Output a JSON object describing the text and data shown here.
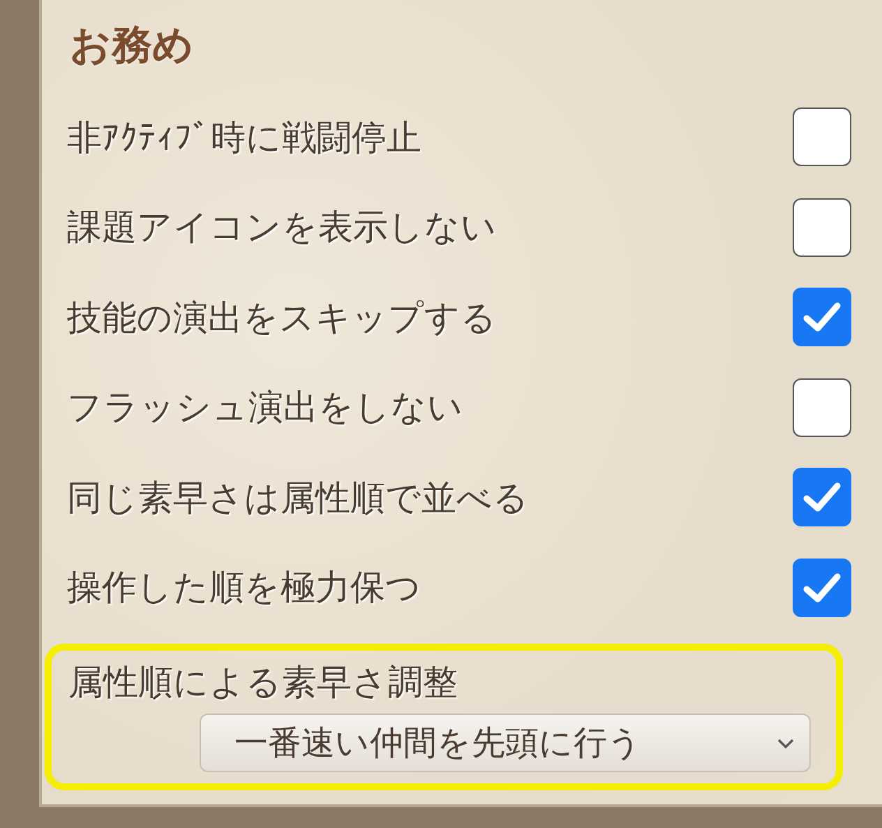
{
  "section": {
    "title": "お務め"
  },
  "options": [
    {
      "label": "非ｱｸﾃｨﾌﾞ時に戦闘停止",
      "checked": false
    },
    {
      "label": "課題アイコンを表示しない",
      "checked": false
    },
    {
      "label": "技能の演出をスキップする",
      "checked": true
    },
    {
      "label": "フラッシュ演出をしない",
      "checked": false
    },
    {
      "label": "同じ素早さは属性順で並べる",
      "checked": true
    },
    {
      "label": "操作した順を極力保つ",
      "checked": true
    }
  ],
  "dropdown_setting": {
    "label": "属性順による素早さ調整",
    "value": "一番速い仲間を先頭に行う",
    "highlighted": true
  }
}
